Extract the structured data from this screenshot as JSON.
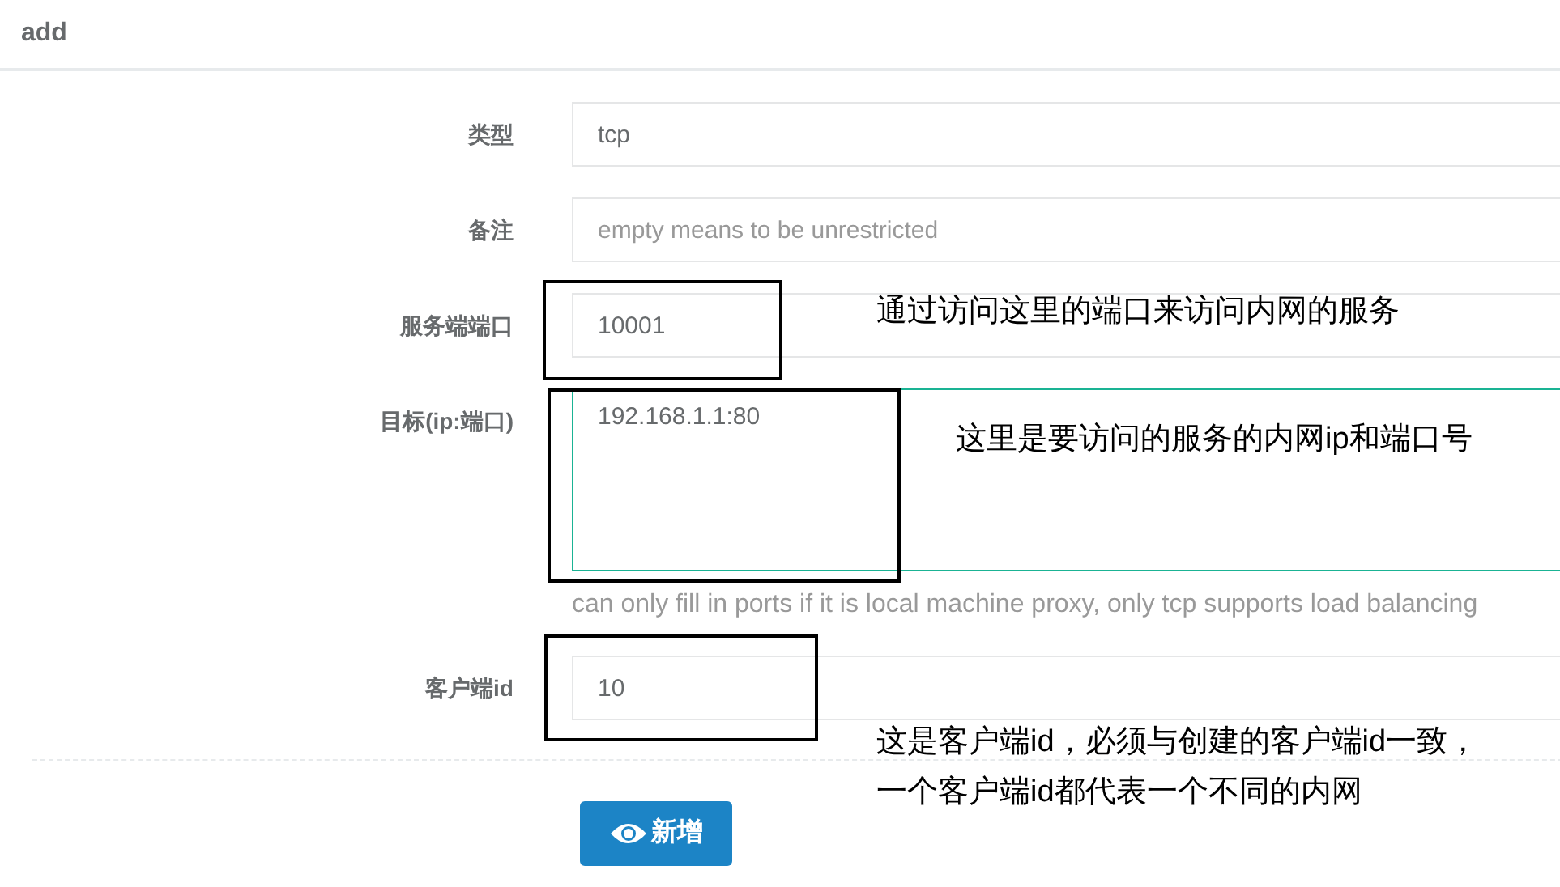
{
  "title": "add",
  "fields": [
    {
      "label": "类型",
      "kind": "input",
      "value": "tcp",
      "focused": false
    },
    {
      "label": "备注",
      "kind": "input",
      "placeholder": "empty means to be unrestricted",
      "focused": false
    },
    {
      "label": "服务端端口",
      "kind": "input",
      "value": "10001",
      "focused": false
    },
    {
      "label": "目标(ip:端口)",
      "kind": "textarea",
      "value": "192.168.1.1:80",
      "focused": true,
      "help": "can only fill in ports if it is local machine proxy, only tcp supports load balancing"
    },
    {
      "label": "客户端id",
      "kind": "input",
      "value": "10",
      "focused": false
    }
  ],
  "submit_button": "新增",
  "annotations": [
    {
      "note": "通过访问这里的端口来访问内网的服务"
    },
    {
      "note": "这里是要访问的服务的内网ip和端口号"
    },
    {
      "note": "这是客户端id，必须与创建的客户端id一致，一个客户端id都代表一个不同的内网"
    }
  ]
}
